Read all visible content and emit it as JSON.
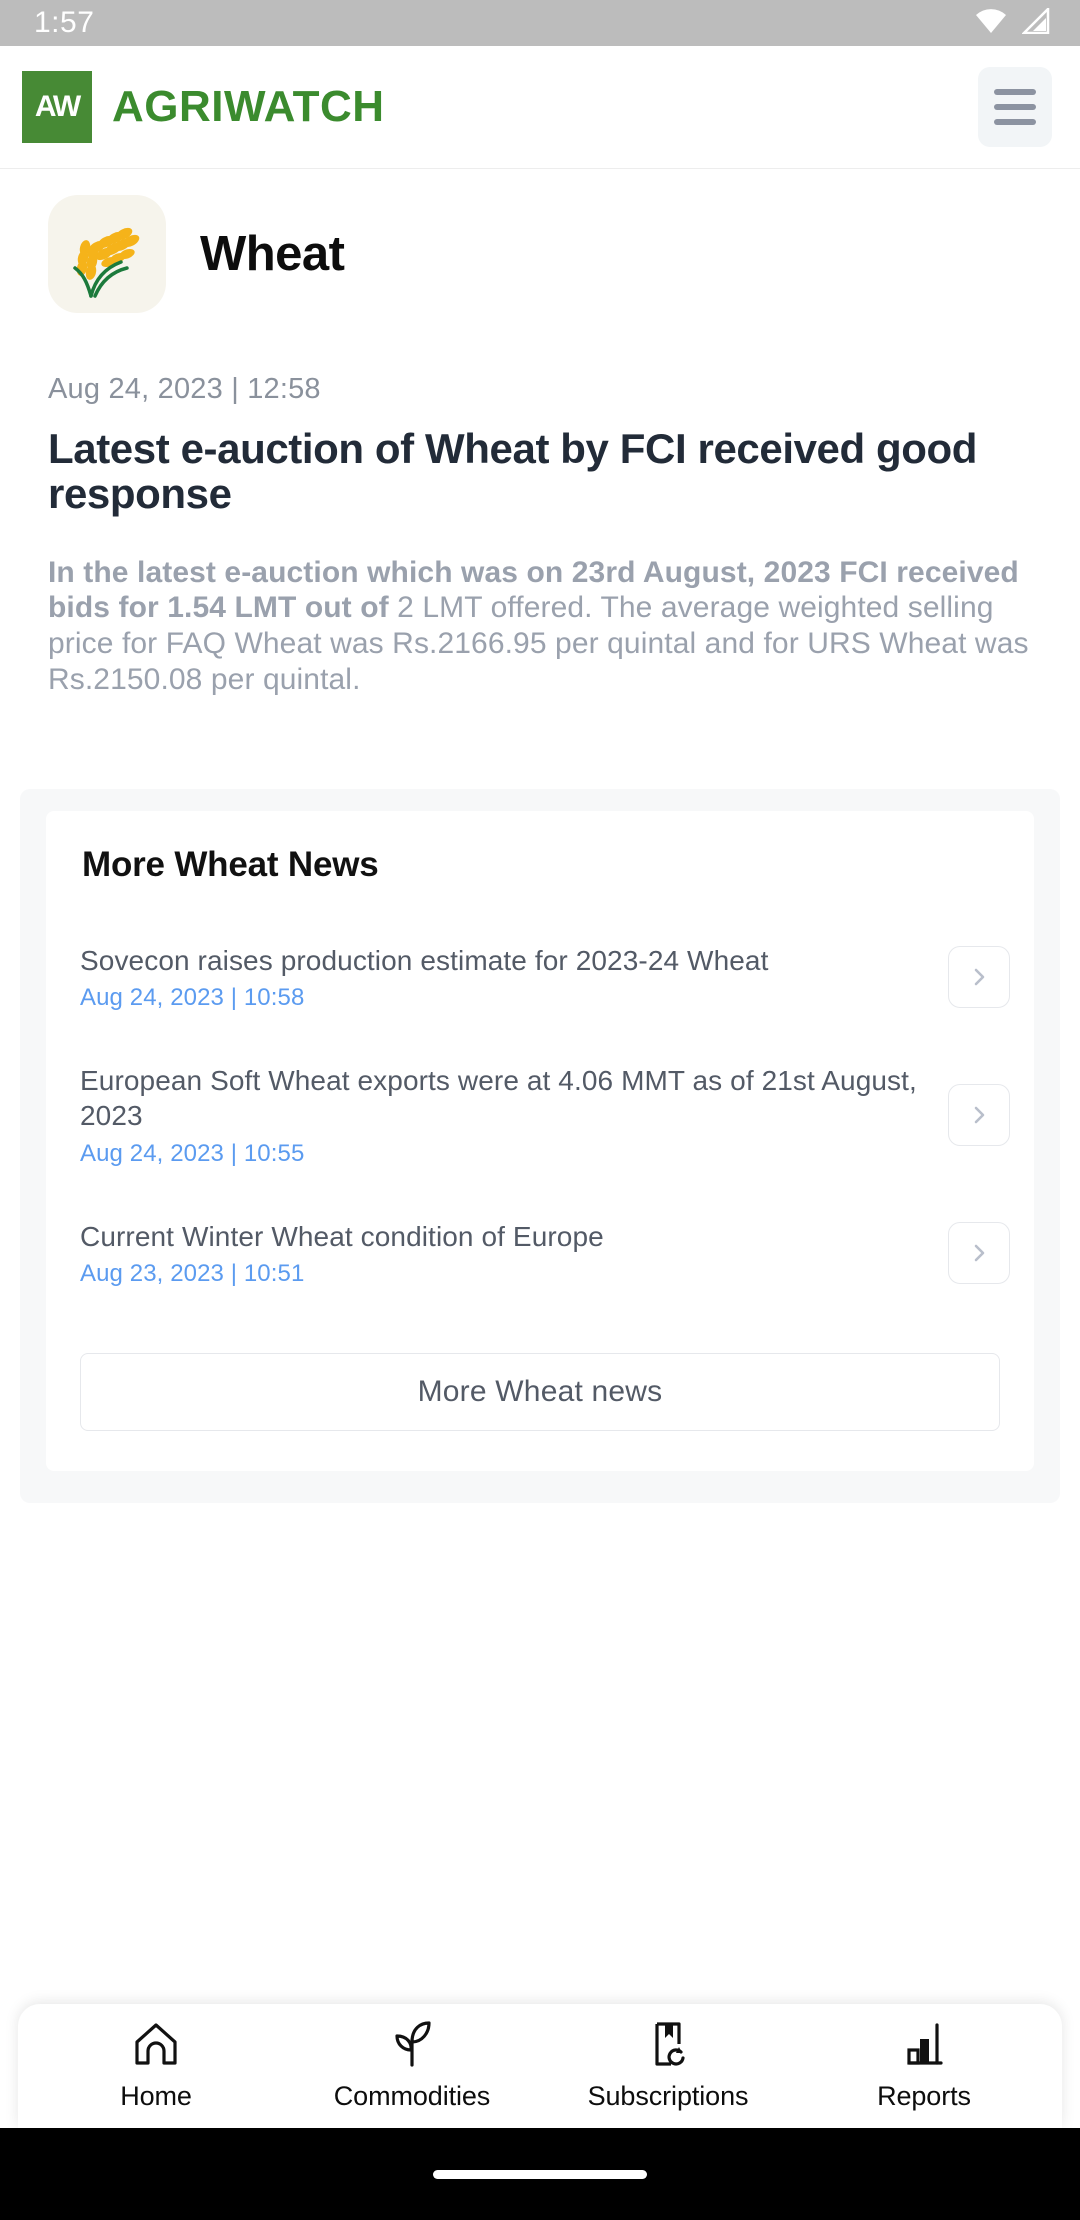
{
  "status_bar": {
    "time": "1:57",
    "icons": [
      "wifi-icon",
      "cellular-signal-icon"
    ]
  },
  "header": {
    "logo_mark_text": "AW",
    "brand_name": "AGRIWATCH",
    "menu_icon": "hamburger-menu-icon",
    "brand_color": "#3b8b2e",
    "logo_bg_color": "#478a35"
  },
  "commodity": {
    "name": "Wheat",
    "icon": "wheat-stalk-icon"
  },
  "article": {
    "date": "Aug 24, 2023 | 12:58",
    "title": "Latest e-auction of Wheat by FCI received good response",
    "body_bold": "In the latest e-auction which was on 23rd August, 2023 FCI received bids for 1.54 LMT out of",
    "body_rest": " 2 LMT offered. The average weighted selling price for FAQ Wheat was Rs.2166.95 per quintal and for URS Wheat was Rs.2150.08 per quintal."
  },
  "news_panel": {
    "title": "More Wheat News",
    "items": [
      {
        "title": "Sovecon raises production estimate for 2023-24 Wheat",
        "date": "Aug 24, 2023 | 10:58",
        "chevron": "chevron-right-icon"
      },
      {
        "title": "European Soft Wheat exports were at 4.06 MMT as of 21st August, 2023",
        "date": "Aug 24, 2023 | 10:55",
        "chevron": "chevron-right-icon"
      },
      {
        "title": "Current Winter Wheat condition of Europe",
        "date": "Aug 23, 2023 | 10:51",
        "chevron": "chevron-right-icon"
      }
    ],
    "more_button_label": "More Wheat news",
    "date_color": "#5b9bf0"
  },
  "bottom_nav": {
    "items": [
      {
        "label": "Home",
        "icon": "home-icon"
      },
      {
        "label": "Commodities",
        "icon": "plant-sprout-icon"
      },
      {
        "label": "Subscriptions",
        "icon": "bookmark-refresh-icon"
      },
      {
        "label": "Reports",
        "icon": "bar-chart-icon"
      }
    ]
  }
}
